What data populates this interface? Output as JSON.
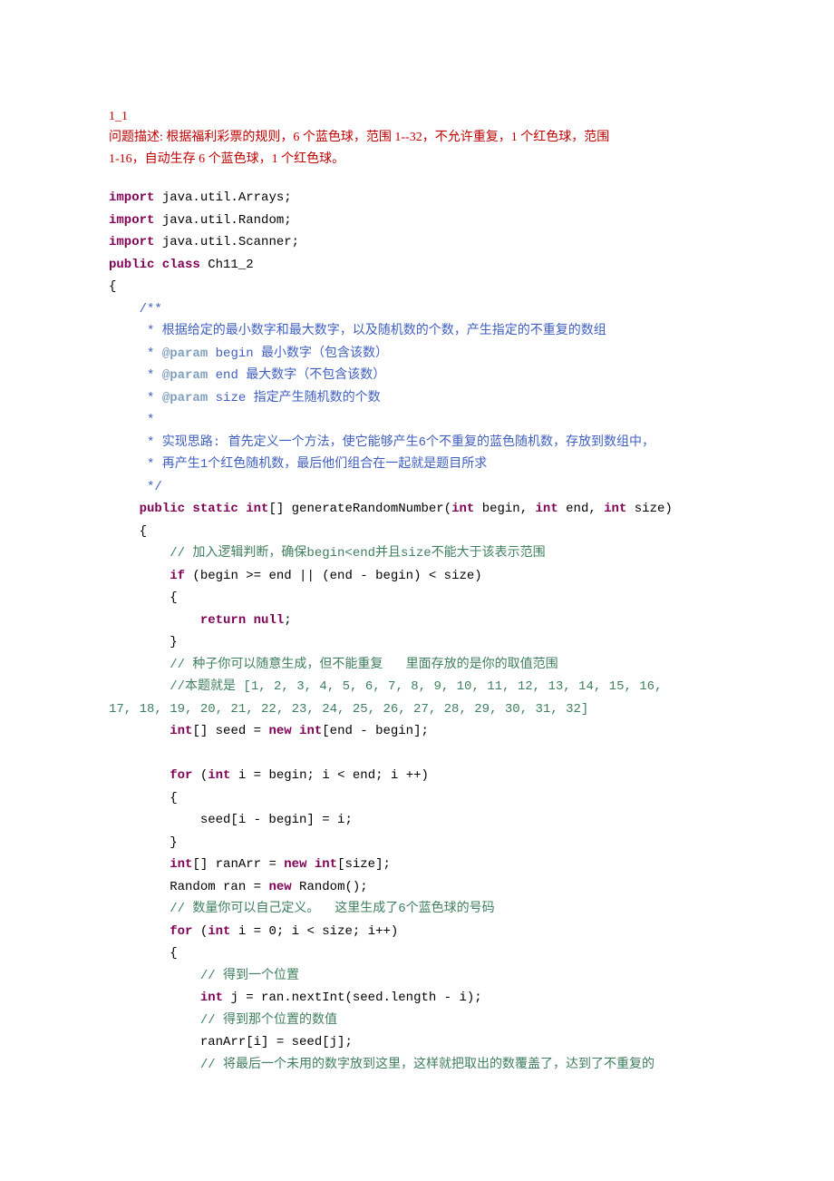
{
  "header": {
    "title": "1_1",
    "desc_line1_a": "问题描述: 根据福利彩票的规则，",
    "desc_line1_b": "6 个蓝色球，范围 1--32，不允许重复，1 个红色球，范围",
    "desc_line2": "1-16，自动生存 6 个蓝色球，1 个红色球。"
  },
  "code": {
    "l1_kw": "import",
    "l1_rest": " java.util.Arrays;",
    "l2_kw": "import",
    "l2_rest": " java.util.Random;",
    "l3_kw": "import",
    "l3_rest": " java.util.Scanner;",
    "l4_kw1": "public class",
    "l4_rest": " Ch11_2",
    "l5": "{",
    "jdoc_open": "    /**",
    "jdoc1": "     * 根据给定的最小数字和最大数字，以及随机数的个数，产生指定的不重复的数组",
    "jdoc2_a": "     * ",
    "jdoc2_tag": "@param",
    "jdoc2_p": " begin",
    "jdoc2_t": " 最小数字（包含该数）",
    "jdoc3_a": "     * ",
    "jdoc3_tag": "@param",
    "jdoc3_p": " end",
    "jdoc3_t": " 最大数字（不包含该数）",
    "jdoc4_a": "     * ",
    "jdoc4_tag": "@param",
    "jdoc4_p": " size",
    "jdoc4_t": " 指定产生随机数的个数",
    "jdoc5": "     *",
    "jdoc6": "     * 实现思路: 首先定义一个方法，使它能够产生6个不重复的蓝色随机数，存放到数组中，",
    "jdoc7": "     * 再产生1个红色随机数，最后他们组合在一起就是题目所求",
    "jdoc_close": "     */",
    "m1_pre": "    ",
    "m1_kw1": "public static int",
    "m1_mid": "[] generateRandomNumber(",
    "m1_kw2": "int",
    "m1_p1": " begin, ",
    "m1_kw3": "int",
    "m1_p2": " end, ",
    "m1_kw4": "int",
    "m1_p3": " size)",
    "m2": "    {",
    "c1": "        // 加入逻辑判断，确保begin<end并且size不能大于该表示范围",
    "m3_pre": "        ",
    "m3_kw": "if",
    "m3_rest": " (begin >= end || (end - begin) < size)",
    "m4": "        {",
    "m5_pre": "            ",
    "m5_kw": "return null",
    "m5_rest": ";",
    "m6": "        }",
    "c2": "        // 种子你可以随意生成，但不能重复   里面存放的是你的取值范围",
    "c3a": "        //本题就是 [1, 2, 3, 4, 5, 6, 7, 8, 9, 10, 11, 12, 13, 14, 15, 16,",
    "c3b": "17, 18, 19, 20, 21, 22, 23, 24, 25, 26, 27, 28, 29, 30, 31, 32]",
    "m7_pre": "        ",
    "m7_kw1": "int",
    "m7_mid": "[] seed = ",
    "m7_kw2": "new int",
    "m7_rest": "[end - begin];",
    "blank1": "",
    "m8_pre": "        ",
    "m8_kw1": "for",
    "m8_mid1": " (",
    "m8_kw2": "int",
    "m8_rest": " i = begin; i < end; i ++)",
    "m9": "        {",
    "m10": "            seed[i - begin] = i;",
    "m11": "        }",
    "m12_pre": "        ",
    "m12_kw1": "int",
    "m12_mid": "[] ranArr = ",
    "m12_kw2": "new int",
    "m12_rest": "[size];",
    "m13_pre": "        Random ran = ",
    "m13_kw": "new",
    "m13_rest": " Random();",
    "c4": "        // 数量你可以自己定义。  这里生成了6个蓝色球的号码",
    "m14_pre": "        ",
    "m14_kw1": "for",
    "m14_mid1": " (",
    "m14_kw2": "int",
    "m14_rest": " i = 0; i < size; i++)",
    "m15": "        {",
    "c5": "            // 得到一个位置",
    "m16_pre": "            ",
    "m16_kw": "int",
    "m16_rest": " j = ran.nextInt(seed.length - i);",
    "c6": "            // 得到那个位置的数值",
    "m17": "            ranArr[i] = seed[j];",
    "c7": "            // 将最后一个未用的数字放到这里，这样就把取出的数覆盖了，达到了不重复的"
  }
}
